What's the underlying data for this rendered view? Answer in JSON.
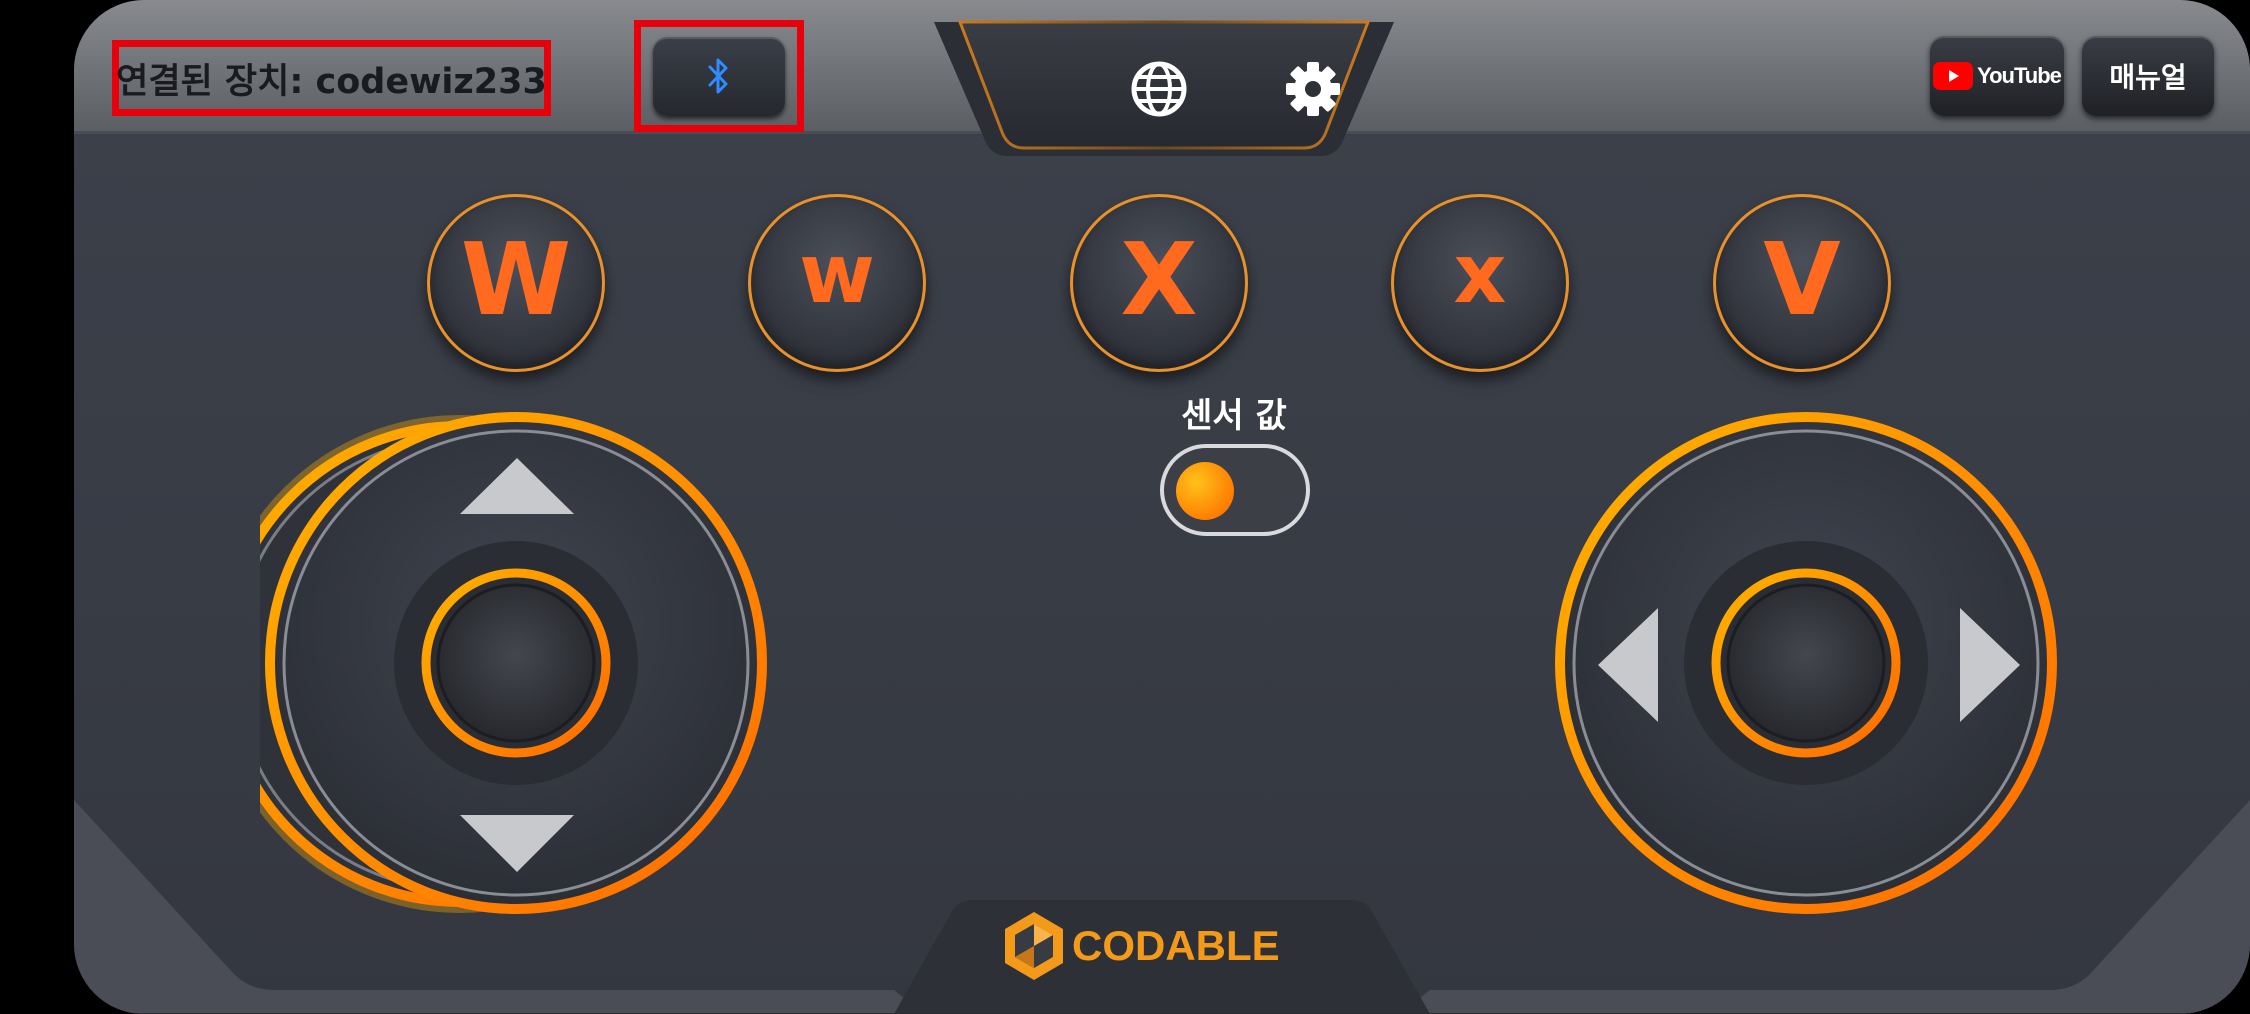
{
  "header": {
    "connected_device": "연결된 장치: codewiz233",
    "youtube_label": "YouTube",
    "manual_label": "매뉴얼"
  },
  "icons": {
    "bluetooth": "bluetooth-icon",
    "language": "globe-icon",
    "settings": "gear-icon",
    "youtube": "youtube-icon"
  },
  "buttons": [
    {
      "key": "W"
    },
    {
      "key": "w"
    },
    {
      "key": "X"
    },
    {
      "key": "x"
    },
    {
      "key": "V"
    }
  ],
  "sensor": {
    "label": "센서 값",
    "toggle_on": false
  },
  "footer": {
    "brand": "CODABLE"
  },
  "colors": {
    "accent_orange": "#ff6a1e",
    "ring_orange": "#ffa500",
    "highlight_red": "#e8000a",
    "bluetooth_blue": "#2f8bff"
  }
}
